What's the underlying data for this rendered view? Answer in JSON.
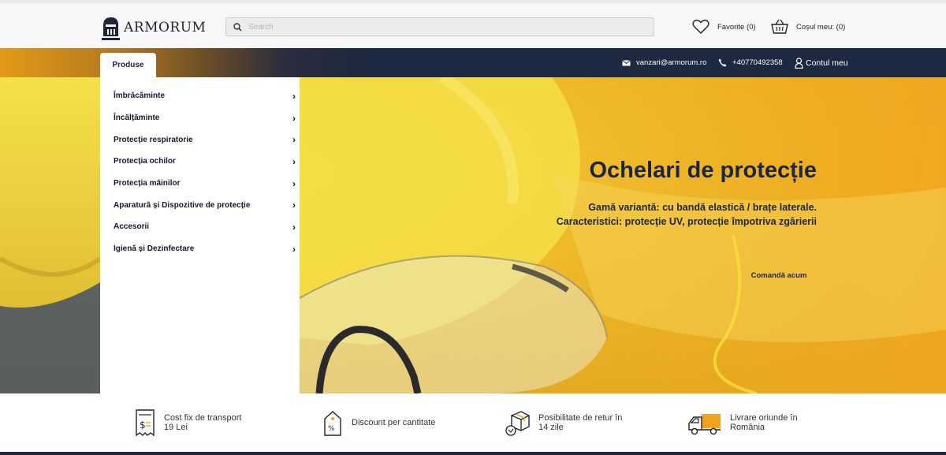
{
  "header": {
    "logo_text": "ARMORUM",
    "search_placeholder": "Search",
    "favorites_label": "Favorite (0)",
    "cart_label": "Coșul meu: (0)"
  },
  "nav": {
    "products_tab": "Produse",
    "email": "vanzari@armorum.ro",
    "phone": "+40770492358",
    "account": "Contul meu"
  },
  "menu": {
    "items": [
      "Îmbrăcăminte",
      "Încălțăminte",
      "Protecție respiratorie",
      "Protecția ochilor",
      "Protecția mâinilor",
      "Aparatură și Dispozitive de protecție",
      "Accesorii",
      "Igienă și Dezinfectare"
    ]
  },
  "hero": {
    "title": "Ochelari de protecție",
    "subtitle_line1": "Gamă variantă: cu bandă elastică / brațe laterale.",
    "subtitle_line2": "Caracteristici: protecție UV, protecție împotriva zgârierii",
    "cta": "Comandă acum"
  },
  "features": [
    {
      "icon": "receipt-icon",
      "text": "Cost fix de transport 19 Lei"
    },
    {
      "icon": "discount-tag-icon",
      "text": "Discount per cantitate"
    },
    {
      "icon": "return-box-icon",
      "text": "Posibilitate de retur în 14 zile"
    },
    {
      "icon": "delivery-truck-icon",
      "text": "Livrare oriunde în România"
    }
  ],
  "colors": {
    "navy": "#1c2940",
    "accent_orange": "#f2a21c",
    "hero_yellow": "#eec531"
  }
}
